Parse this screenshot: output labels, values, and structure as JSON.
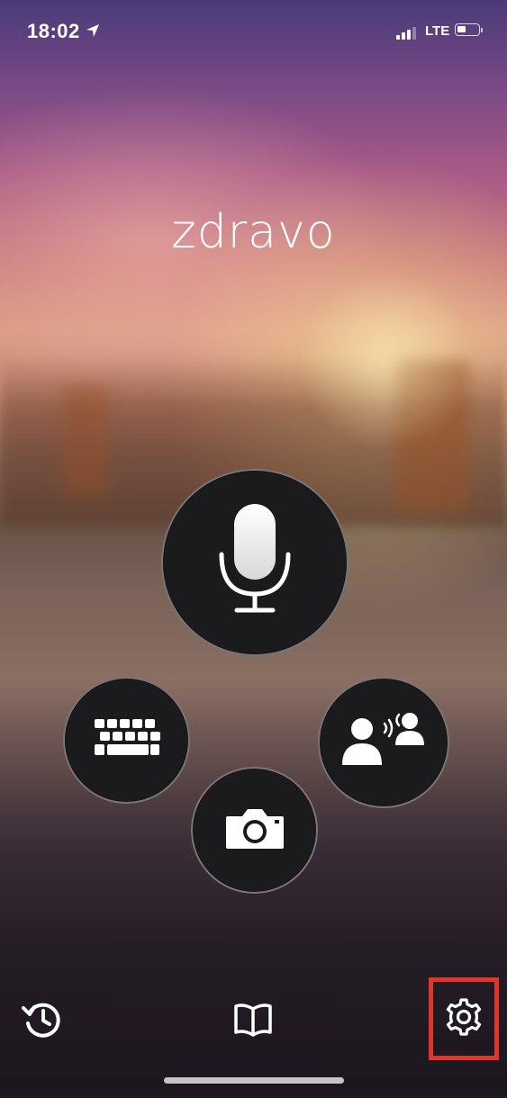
{
  "status_bar": {
    "time": "18:02",
    "network": "LTE",
    "signal_bars": 3,
    "battery_fraction": 0.45
  },
  "greeting": "zdravo",
  "actions": {
    "microphone": {
      "icon": "microphone-icon"
    },
    "keyboard": {
      "icon": "keyboard-icon"
    },
    "camera": {
      "icon": "camera-icon"
    },
    "conversation": {
      "icon": "conversation-icon"
    }
  },
  "bottom_bar": {
    "history": {
      "icon": "history-icon"
    },
    "phrasebook": {
      "icon": "book-icon"
    },
    "settings": {
      "icon": "gear-icon",
      "highlight_color": "#e0352b"
    }
  }
}
